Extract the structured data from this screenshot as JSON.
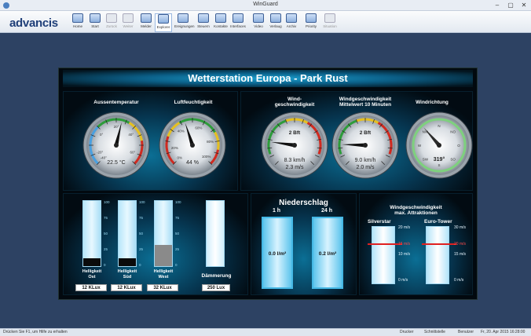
{
  "window": {
    "title": "WinGuard",
    "minimize": "–",
    "maximize": "▢",
    "close": "✕"
  },
  "toolbar": {
    "logo": "advancis",
    "items": [
      {
        "label": "Home",
        "icon": "home-icon",
        "enabled": true
      },
      {
        "label": "Start",
        "icon": "start-icon",
        "enabled": true
      },
      {
        "label": "Zurück",
        "icon": "back-arrow-icon",
        "enabled": false
      },
      {
        "label": "Weiter",
        "icon": "forward-arrow-icon",
        "enabled": false
      },
      {
        "label": "Melder",
        "icon": "detector-icon",
        "enabled": true
      },
      {
        "label": "Explorer",
        "icon": "explorer-icon",
        "enabled": true,
        "active": true
      },
      {
        "label": "Ereignungen",
        "icon": "events-icon",
        "enabled": true
      },
      {
        "label": "Steuern",
        "icon": "control-icon",
        "enabled": true
      },
      {
        "label": "Kontakte",
        "icon": "contacts-icon",
        "enabled": true
      },
      {
        "label": "Interfaces",
        "icon": "interfaces-icon",
        "enabled": true
      },
      {
        "label": "Video",
        "icon": "video-icon",
        "enabled": true
      },
      {
        "label": "Verlaug",
        "icon": "history-icon",
        "enabled": true
      },
      {
        "label": "Archiv",
        "icon": "archive-icon",
        "enabled": true
      },
      {
        "label": "Priority",
        "icon": "priority-icon",
        "enabled": true
      },
      {
        "label": "Situation",
        "icon": "situation-icon",
        "enabled": false
      }
    ]
  },
  "station": {
    "title": "Wetterstation Europa - Park Rust",
    "temp": {
      "label": "Aussentemperatur",
      "value": "22.5 °C",
      "ticks": [
        "-20°",
        "0°",
        "20°",
        "40°",
        "60°",
        "-40°"
      ]
    },
    "humidity": {
      "label": "Luftfeuchtigkeit",
      "value": "44 %",
      "ticks": [
        "20%",
        "40%",
        "60%",
        "80%",
        "100%",
        "0%"
      ]
    },
    "wind": {
      "label": "Wind-\ngeschwindigkeit",
      "bft": "2 Bft",
      "kmh": "8.3 km/h",
      "ms": "2.3 m/s"
    },
    "wind10": {
      "label": "Windgeschwindigkeit\nMittelwert 10 Minuten",
      "bft": "2 Bft",
      "kmh": "9.0 km/h",
      "ms": "2.0 m/s"
    },
    "dir": {
      "label": "Windrichtung",
      "value": "319",
      "unit": "°",
      "points": [
        "N",
        "NO",
        "O",
        "SO",
        "S",
        "SW",
        "W",
        "NW"
      ]
    },
    "light": {
      "sensors": [
        {
          "label": "Helligkeit\nOst",
          "value": "12 KLux",
          "level": 0.12
        },
        {
          "label": "Helligkeit\nSüd",
          "value": "12 KLux",
          "level": 0.12
        },
        {
          "label": "Helligkeit\nWest",
          "value": "32 KLux",
          "level": 0.32
        }
      ],
      "dusk": {
        "label": "Dämmerung",
        "value": "250 Lux"
      },
      "scale": [
        "100",
        "75",
        "50",
        "25",
        "0"
      ]
    },
    "rain": {
      "title": "Niederschlag",
      "p1": "1 h",
      "p24": "24 h",
      "v1": "0.0 l/m²",
      "v24": "0.2 l/m²"
    },
    "attr": {
      "title": "Windgeschwindigkeit\nmax. Attraktionen",
      "a1": {
        "name": "Silverstar",
        "t1": "20 m/s",
        "t2": "15 m/s",
        "t3": "10 m/s",
        "t4": "0 m/s"
      },
      "a2": {
        "name": "Euro-Tower",
        "t1": "30 m/s",
        "t2": "20 m/s",
        "t3": "15 m/s",
        "t4": "0 m/s"
      }
    }
  },
  "status": {
    "hint": "Drücken Sie F1, um Hilfe zu erhalten",
    "drucker": "Drucker",
    "schnitt": "Schnittstelle",
    "benutzer": "Benutzer",
    "datetime": "Fr, 20. Apr 2015  16:28:00"
  }
}
